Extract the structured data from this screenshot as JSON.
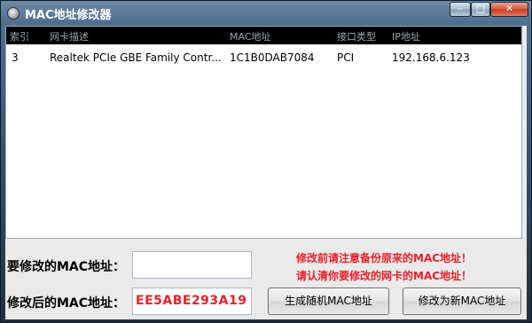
{
  "window": {
    "title": "MAC地址修改器",
    "controls": {
      "minimize": "‒",
      "maximize": "□",
      "close": "✕"
    }
  },
  "list": {
    "columns": [
      "索引",
      "网卡描述",
      "MAC地址",
      "接口类型",
      "IP地址"
    ],
    "rows": [
      {
        "index": "3",
        "description": "Realtek PCIe GBE Family Contr...",
        "mac": "1C1B0DAB7084",
        "interface": "PCI",
        "ip": "192.168.6.123"
      }
    ]
  },
  "form": {
    "target_mac_label": "要修改的MAC地址：",
    "target_mac_value": "",
    "new_mac_label": "修改后的MAC地址：",
    "new_mac_value": "EE5ABE293A19",
    "warning_line1": "修改前请注意备份原来的MAC地址！",
    "warning_line2": "请认清你要修改的网卡的MAC地址！",
    "generate_button": "生成随机MAC地址",
    "apply_button": "修改为新MAC地址"
  },
  "colors": {
    "warning": "#e8202a",
    "header_bg": "#000000"
  }
}
